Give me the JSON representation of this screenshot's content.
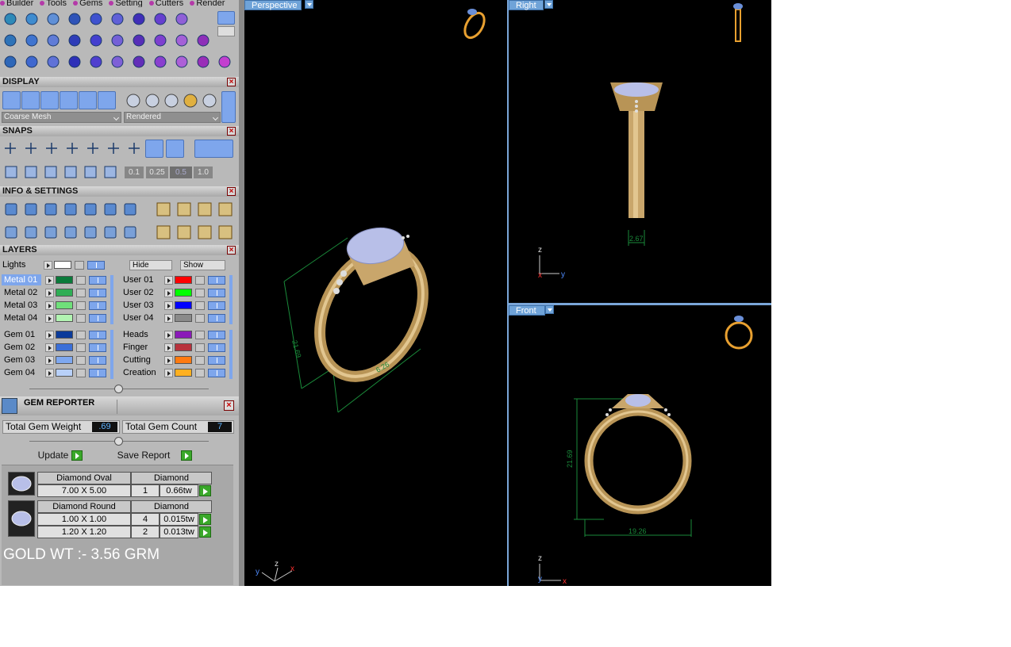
{
  "menu_tabs": [
    "Builder",
    "Tools",
    "Gems",
    "Setting",
    "Cutters",
    "Render"
  ],
  "display": {
    "header": "DISPLAY",
    "mesh_select": "Coarse Mesh",
    "render_select": "Rendered"
  },
  "snaps": {
    "header": "SNAPS",
    "values": [
      "0.1",
      "0.25",
      "0.5",
      "1.0"
    ]
  },
  "info": {
    "header": "INFO & SETTINGS"
  },
  "layers": {
    "header": "LAYERS",
    "lights_label": "Lights",
    "hide_label": "Hide",
    "show_label": "Show",
    "left_group_a": [
      {
        "name": "Metal 01",
        "color": "#0a7a3a",
        "selected": true
      },
      {
        "name": "Metal 02",
        "color": "#2fae55"
      },
      {
        "name": "Metal 03",
        "color": "#6fe07a"
      },
      {
        "name": "Metal 04",
        "color": "#b2f4b2"
      }
    ],
    "right_group_a": [
      {
        "name": "User 01",
        "color": "#ff0000"
      },
      {
        "name": "User 02",
        "color": "#00ff00"
      },
      {
        "name": "User 03",
        "color": "#0000ff"
      },
      {
        "name": "User 04",
        "color": "#8a8a8a"
      }
    ],
    "left_group_b": [
      {
        "name": "Gem 01",
        "color": "#0a3a9a"
      },
      {
        "name": "Gem 02",
        "color": "#3a6fd8"
      },
      {
        "name": "Gem 03",
        "color": "#7ea8f0"
      },
      {
        "name": "Gem 04",
        "color": "#b8d0f8"
      }
    ],
    "right_group_b": [
      {
        "name": "Heads",
        "color": "#8a1ab8"
      },
      {
        "name": "Finger",
        "color": "#b8323c"
      },
      {
        "name": "Cutting",
        "color": "#ff7a10"
      },
      {
        "name": "Creation",
        "color": "#ffb020"
      }
    ]
  },
  "gem_reporter": {
    "header": "GEM REPORTER",
    "weight_label": "Total Gem Weight",
    "weight_value": ".69",
    "count_label": "Total Gem Count",
    "count_value": "7",
    "update_label": "Update",
    "save_label": "Save Report",
    "groups": [
      {
        "shape": "Diamond Oval",
        "material": "Diamond",
        "rows": [
          {
            "size": "7.00 X 5.00",
            "qty": "1",
            "weight": "0.66tw"
          }
        ]
      },
      {
        "shape": "Diamond Round",
        "material": "Diamond",
        "rows": [
          {
            "size": "1.00 X 1.00",
            "qty": "4",
            "weight": "0.015tw"
          },
          {
            "size": "1.20 X 1.20",
            "qty": "2",
            "weight": "0.013tw"
          }
        ]
      }
    ],
    "gold_weight": "GOLD WT :- 3.56 GRM"
  },
  "viewports": {
    "perspective": {
      "label": "Perspective",
      "dim_height": "21.69",
      "dim_width": "6.26"
    },
    "right": {
      "label": "Right",
      "dim_width": "2.67"
    },
    "front": {
      "label": "Front",
      "dim_height": "21.69",
      "dim_width": "19.26"
    }
  },
  "axes": {
    "x": "x",
    "y": "y",
    "z": "z"
  },
  "colors": {
    "accent": "#7ea6ec",
    "gold": "#c9a66b",
    "dim_green": "#1a8a3a"
  }
}
